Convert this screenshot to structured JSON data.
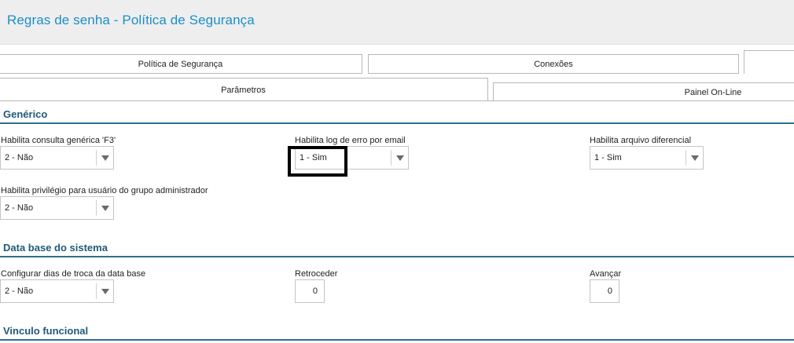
{
  "header": {
    "title": "Regras de senha - Política de Segurança"
  },
  "tabs_top": [
    {
      "label": "Política de Segurança"
    },
    {
      "label": "Conexões"
    },
    {
      "label": ""
    }
  ],
  "tabs_sub": [
    {
      "label": "Parâmetros"
    },
    {
      "label": "Painel On-Line"
    }
  ],
  "sections": {
    "generico": {
      "title": "Genérico",
      "fields": {
        "consulta_generica": {
          "label": "Habilita consulta genérica 'F3'",
          "value": "2 - Não"
        },
        "log_erro_email": {
          "label": "Habilita log de erro por email",
          "value": "1 - Sim"
        },
        "arquivo_diferencial": {
          "label": "Habilita arquivo diferencial",
          "value": "1 - Sim"
        },
        "privilegio_admin": {
          "label": "Habilita privilégio para usuário do grupo administrador",
          "value": "2 - Não"
        }
      }
    },
    "data_base": {
      "title": "Data base do sistema",
      "fields": {
        "dias_troca": {
          "label": "Configurar dias de troca da data base",
          "value": "2 - Não"
        },
        "retroceder": {
          "label": "Retroceder",
          "value": "0"
        },
        "avancar": {
          "label": "Avançar",
          "value": "0"
        }
      }
    },
    "vinculo": {
      "title": "Vinculo funcional"
    }
  }
}
